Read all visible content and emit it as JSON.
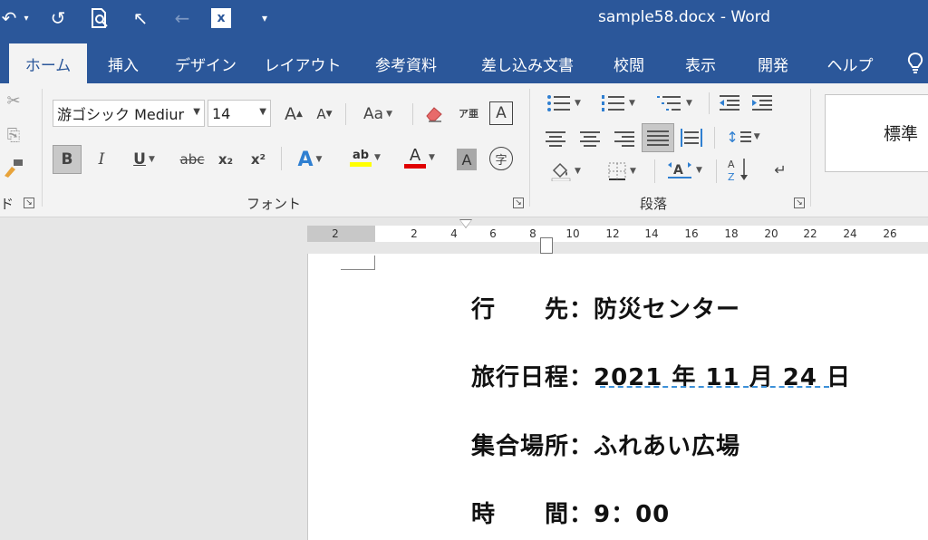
{
  "window": {
    "doc_title": "sample58.docx  -  Word",
    "qat": {
      "undo_icon": "↶",
      "redo_icon": "↺",
      "print_preview_icon": "🔍",
      "pointer_icon": "↖",
      "back_icon": "←",
      "excel_icon": "x",
      "customize_icon": "▾"
    }
  },
  "tabs": [
    {
      "label": "ホーム",
      "active": true
    },
    {
      "label": "挿入"
    },
    {
      "label": "デザイン"
    },
    {
      "label": "レイアウト"
    },
    {
      "label": "参考資料"
    },
    {
      "label": "差し込み文書"
    },
    {
      "label": "校閲"
    },
    {
      "label": "表示"
    },
    {
      "label": "開発"
    },
    {
      "label": "ヘルプ"
    }
  ],
  "ribbon": {
    "clipboard": {
      "label_fragment": "ド",
      "cut_icon": "✂",
      "copy_icon": "⎘",
      "paste_format_icon": "🖌"
    },
    "font": {
      "label": "フォント",
      "font_name": "游ゴシック Mediur",
      "font_size": "14",
      "grow_font": "A",
      "shrink_font": "A",
      "change_case": "Aa",
      "clear_format_icon": "⌫",
      "phonetic_guide": "ア亜",
      "char_border": "A",
      "bold": "B",
      "italic": "I",
      "underline": "U",
      "strikethrough": "abc",
      "subscript": "x₂",
      "superscript": "x²",
      "text_effects": "A",
      "highlight": "ab",
      "font_color": "A",
      "char_shading": "A",
      "enclose_char": "字"
    },
    "paragraph": {
      "label": "段落",
      "sort_icon": "A↓Z",
      "line_spacing_icon": "↕"
    },
    "styles": {
      "normal": "標準"
    }
  },
  "ruler": {
    "ticks": [
      "2",
      "2",
      "4",
      "6",
      "8",
      "10",
      "12",
      "14",
      "16",
      "18",
      "20",
      "22",
      "24",
      "26"
    ]
  },
  "document": {
    "lines": [
      "行　　先：防災センター",
      "旅行日程：2021 年 11 月 24 日",
      "集合場所：ふれあい広場",
      "時　　間：9：00"
    ]
  },
  "colors": {
    "title_bar": "#2b579a",
    "ribbon": "#f3f3f3",
    "highlight_yellow": "#ffff00",
    "font_red": "#e00000",
    "squiggle_blue": "#3c90d8"
  }
}
